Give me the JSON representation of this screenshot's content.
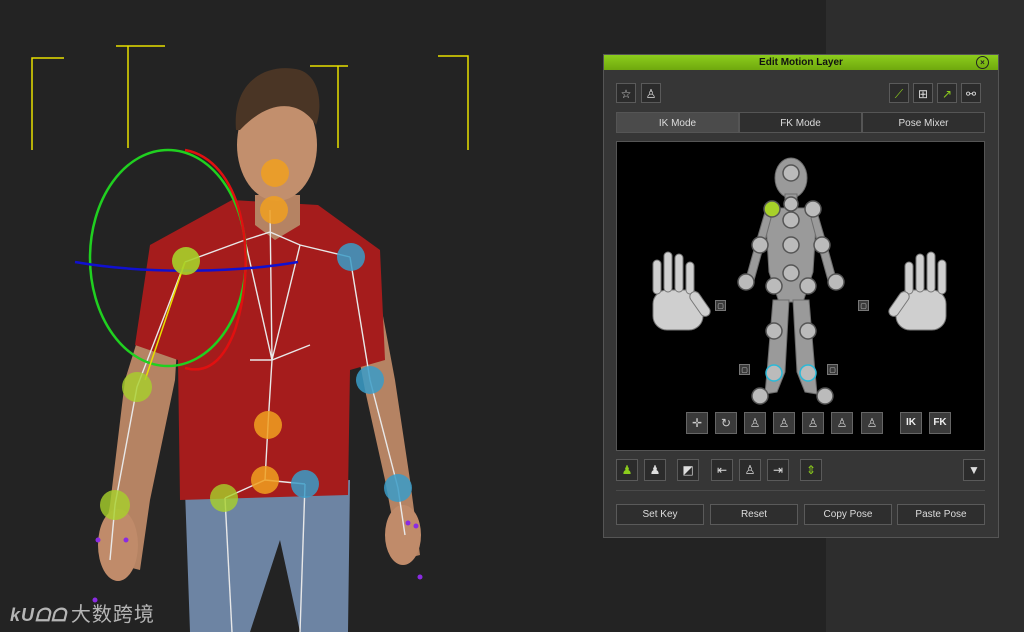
{
  "panel": {
    "title": "Edit Motion Layer",
    "close_icon": "close-circle-icon",
    "tabs": [
      "IK Mode",
      "FK Mode",
      "Pose Mixer"
    ],
    "active_tab": "IK Mode",
    "toolbar_left_icons": [
      "reach-target-icon",
      "pin-figure-icon"
    ],
    "toolbar_right_icons": [
      "bone-select-icon",
      "group-select-icon",
      "effector-icon",
      "link-icon"
    ],
    "pose_buttons": {
      "icons": [
        "move-gizmo-icon",
        "rotate-gizmo-icon",
        "pose-figure-1-icon",
        "pose-figure-2-icon",
        "pose-figure-3-icon",
        "pose-figure-4-icon",
        "pose-figure-5-icon"
      ],
      "ik_label": "IK",
      "fk_label": "FK"
    },
    "bottom_toolbar_icons": [
      "full-body-icon",
      "half-body-icon",
      "mirror-icon",
      "flip-left-icon",
      "figure-center-icon",
      "flip-right-icon",
      "align-icon",
      "dropdown-arrow-icon"
    ],
    "actions": [
      "Set Key",
      "Reset",
      "Copy Pose",
      "Paste Pose"
    ]
  },
  "watermark": {
    "logo": "kUᗝᗝ",
    "text": "大数跨境"
  },
  "colors": {
    "accent": "#8ccd1c",
    "joint_orange": "#f0a020",
    "joint_green": "#a7d12a",
    "joint_blue": "#3a9cc8",
    "gizmo_red": "#e01010",
    "gizmo_green": "#20d020",
    "gizmo_blue": "#1010d0",
    "shirt": "#a51c1c",
    "jeans": "#6d84a3"
  }
}
